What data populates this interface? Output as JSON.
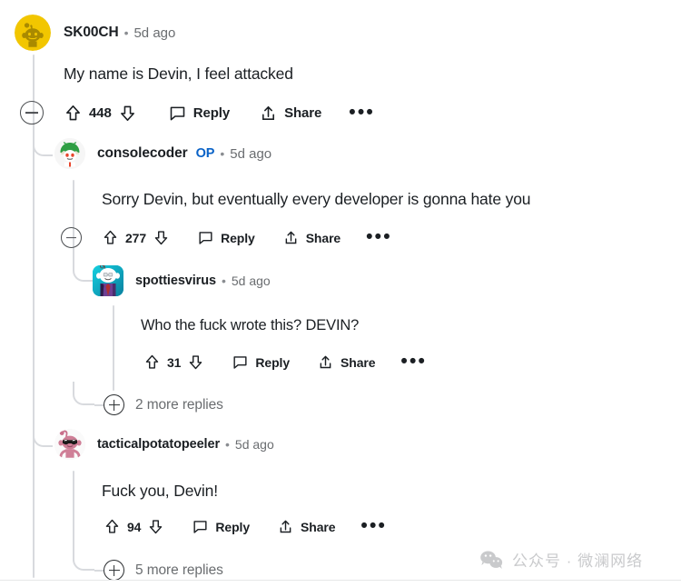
{
  "watermark": {
    "icon": "wechat-icon",
    "text": "公众号 · 微澜网络"
  },
  "labels": {
    "reply": "Reply",
    "share": "Share",
    "more_options": "•••",
    "separator_dot": "•",
    "op": "OP"
  },
  "comments": [
    {
      "id": "c1",
      "depth": 0,
      "author": "SK00CH",
      "is_op": false,
      "timestamp": "5d ago",
      "body": "My name is Devin, I feel attacked",
      "score": "448",
      "has_collapse": true,
      "avatar": "snoo-yellow-avatar",
      "upvote_icon": "upvote-arrow-icon",
      "downvote_icon": "downvote-arrow-icon",
      "reply_icon": "comment-bubble-icon",
      "share_icon": "share-arrow-icon",
      "overflow_icon": "more-options-icon"
    },
    {
      "id": "c2",
      "depth": 1,
      "author": "consolecoder",
      "is_op": true,
      "timestamp": "5d ago",
      "body": "Sorry Devin, but eventually every developer is gonna hate you",
      "score": "277",
      "has_collapse": true,
      "avatar": "snoo-green-hood-avatar",
      "upvote_icon": "upvote-arrow-icon",
      "downvote_icon": "downvote-arrow-icon",
      "reply_icon": "comment-bubble-icon",
      "share_icon": "share-arrow-icon",
      "overflow_icon": "more-options-icon"
    },
    {
      "id": "c3",
      "depth": 2,
      "author": "spottiesvirus",
      "is_op": false,
      "timestamp": "5d ago",
      "body": "Who the fuck wrote this? DEVIN?",
      "score": "31",
      "has_collapse": false,
      "avatar": "snoo-teal-purple-avatar",
      "upvote_icon": "upvote-arrow-icon",
      "downvote_icon": "downvote-arrow-icon",
      "reply_icon": "comment-bubble-icon",
      "share_icon": "share-arrow-icon",
      "overflow_icon": "more-options-icon"
    },
    {
      "id": "c4",
      "depth": 1,
      "author": "tacticalpotatopeeler",
      "is_op": false,
      "timestamp": "5d ago",
      "body": "Fuck you, Devin!",
      "score": "94",
      "has_collapse": false,
      "avatar": "snoo-pink-sunglasses-avatar",
      "upvote_icon": "upvote-arrow-icon",
      "downvote_icon": "downvote-arrow-icon",
      "reply_icon": "comment-bubble-icon",
      "share_icon": "share-arrow-icon",
      "overflow_icon": "more-options-icon"
    }
  ],
  "more_replies": [
    {
      "id": "mr1",
      "label": "2 more replies",
      "icon": "expand-plus-icon"
    },
    {
      "id": "mr2",
      "label": "5 more replies",
      "icon": "expand-plus-icon"
    }
  ],
  "colors": {
    "op_blue": "#0962c7",
    "thread_line": "#d8dade",
    "meta_gray": "#6a6d70",
    "text": "#1b1f23",
    "watermark_gray": "#c9cacc",
    "background": "#ffffff"
  }
}
